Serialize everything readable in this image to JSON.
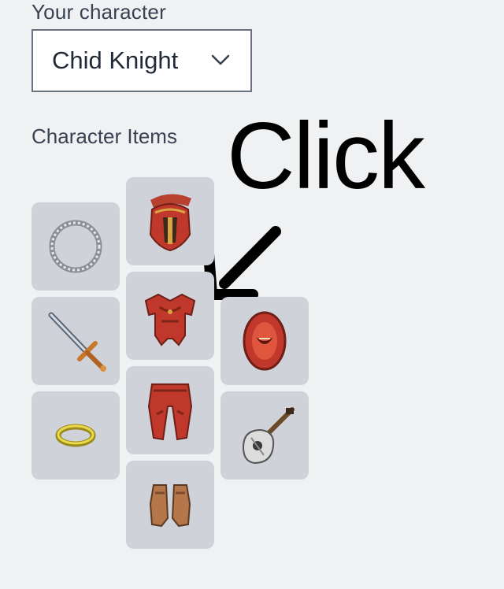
{
  "character_label": "Your character",
  "character_select": {
    "value": "Chid Knight",
    "icon": "chevron-down-icon"
  },
  "items_heading": "Character Items",
  "annotation": {
    "text": "Click",
    "icon": "arrow-icon"
  },
  "slots": [
    {
      "name": "ring-slot",
      "item": "silver-ring-icon"
    },
    {
      "name": "helmet-slot",
      "item": "helmet-icon"
    },
    {
      "name": "weapon-slot",
      "item": "sword-icon"
    },
    {
      "name": "armor-slot",
      "item": "armor-icon"
    },
    {
      "name": "shield-slot",
      "item": "shield-icon"
    },
    {
      "name": "accessory-slot",
      "item": "gold-ring-icon"
    },
    {
      "name": "legs-slot",
      "item": "legs-icon"
    },
    {
      "name": "offhand-slot",
      "item": "instrument-icon"
    },
    {
      "name": "boots-slot",
      "item": "boots-icon"
    }
  ],
  "colors": {
    "background": "#f0f1f3",
    "slot": "#cfd2d8",
    "item_red": "#c0382b"
  }
}
